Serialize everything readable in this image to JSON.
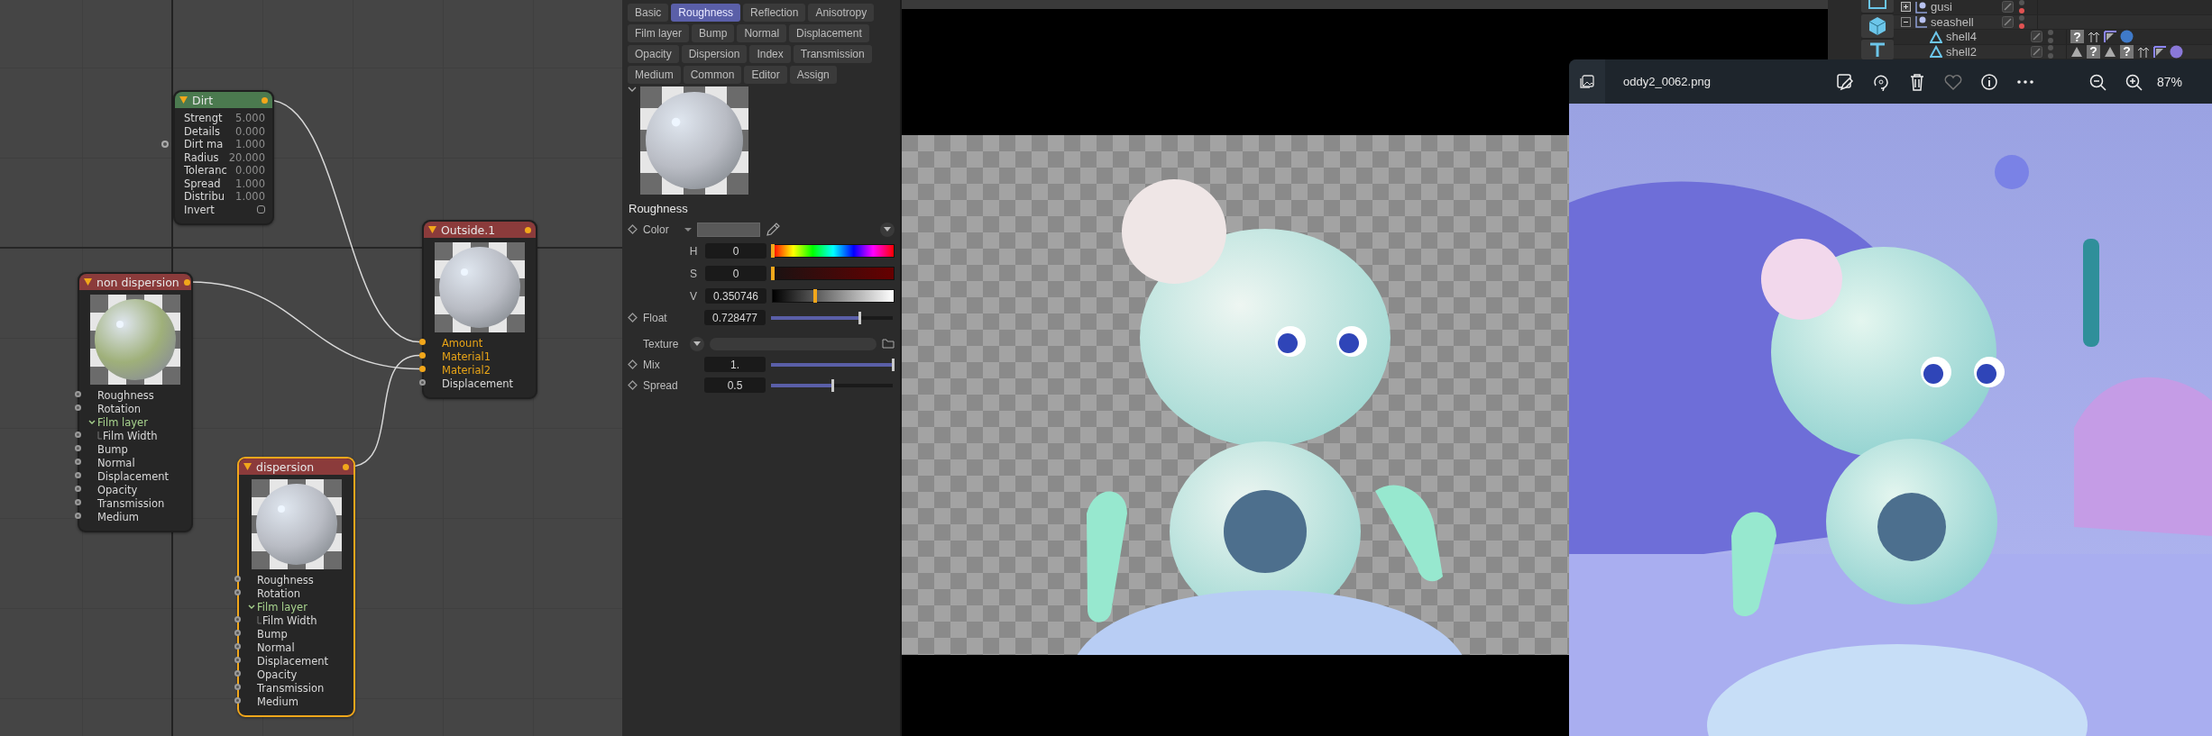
{
  "node_editor": {
    "nodes": [
      {
        "title": "Dirt",
        "kind": "texture",
        "selected": false,
        "params": [
          {
            "label": "Strengt",
            "value": "5.000",
            "input": false
          },
          {
            "label": "Details",
            "value": "0.000",
            "input": false
          },
          {
            "label": "Dirt ma",
            "value": "1.000",
            "input": true
          },
          {
            "label": "Radius",
            "value": "20.000",
            "input": false
          },
          {
            "label": "Toleranc",
            "value": "0.000",
            "input": false
          },
          {
            "label": "Spread",
            "value": "1.000",
            "input": false
          },
          {
            "label": "Distribu",
            "value": "1.000",
            "input": false
          }
        ],
        "checkbox": {
          "label": "Invert",
          "checked": false
        }
      },
      {
        "title": "Outside.1",
        "kind": "mix",
        "selected": false,
        "inputs": [
          {
            "label": "Amount",
            "connected": true
          },
          {
            "label": "Material1",
            "connected": true
          },
          {
            "label": "Material2",
            "connected": true
          },
          {
            "label": "Displacement",
            "connected": false
          }
        ]
      },
      {
        "title": "non dispersion",
        "kind": "material",
        "selected": false,
        "inputs": [
          {
            "label": "Roughness",
            "connected": false
          },
          {
            "label": "Rotation",
            "connected": false
          },
          {
            "label": "Film layer",
            "expanded": true,
            "children": [
              {
                "label": "Film Width",
                "connected": false
              }
            ]
          },
          {
            "label": "Bump",
            "connected": false
          },
          {
            "label": "Normal",
            "connected": false
          },
          {
            "label": "Displacement",
            "connected": false
          },
          {
            "label": "Opacity",
            "connected": false
          },
          {
            "label": "Transmission",
            "connected": false
          },
          {
            "label": "Medium",
            "connected": false
          }
        ]
      },
      {
        "title": "dispersion",
        "kind": "material",
        "selected": true,
        "inputs": [
          {
            "label": "Roughness",
            "connected": false
          },
          {
            "label": "Rotation",
            "connected": false
          },
          {
            "label": "Film layer",
            "expanded": true,
            "children": [
              {
                "label": "Film Width",
                "connected": false
              }
            ]
          },
          {
            "label": "Bump",
            "connected": false
          },
          {
            "label": "Normal",
            "connected": false
          },
          {
            "label": "Displacement",
            "connected": false
          },
          {
            "label": "Opacity",
            "connected": false
          },
          {
            "label": "Transmission",
            "connected": false
          },
          {
            "label": "Medium",
            "connected": false
          }
        ]
      }
    ]
  },
  "material_panel": {
    "tab_rows": [
      [
        {
          "label": "Basic",
          "selected": false
        },
        {
          "label": "Roughness",
          "selected": true
        },
        {
          "label": "Reflection",
          "selected": false
        },
        {
          "label": "Anisotropy",
          "selected": false
        }
      ],
      [
        {
          "label": "Film layer",
          "selected": false
        },
        {
          "label": "Bump",
          "selected": false
        },
        {
          "label": "Normal",
          "selected": false
        },
        {
          "label": "Displacement",
          "selected": false
        }
      ],
      [
        {
          "label": "Opacity",
          "selected": false
        },
        {
          "label": "Dispersion",
          "selected": false
        },
        {
          "label": "Index",
          "selected": false
        },
        {
          "label": "Transmission",
          "selected": false
        }
      ],
      [
        {
          "label": "Medium",
          "selected": false
        },
        {
          "label": "Common",
          "selected": false
        },
        {
          "label": "Editor",
          "selected": false
        },
        {
          "label": "Assign",
          "selected": false
        }
      ]
    ],
    "section": "Roughness",
    "color": {
      "label": "Color",
      "channels": [
        {
          "label": "H",
          "value": "0",
          "level": 0
        },
        {
          "label": "S",
          "value": "0",
          "level": 0
        },
        {
          "label": "V",
          "value": "0.350746",
          "level": 0.350746
        }
      ]
    },
    "float": {
      "label": "Float",
      "value": "0.728477",
      "level": 0.728477
    },
    "texture": {
      "label": "Texture"
    },
    "mix": {
      "label": "Mix",
      "value": "1.",
      "level": 1
    },
    "spread": {
      "label": "Spread",
      "value": "0.5",
      "level": 0.5
    }
  },
  "outliner": {
    "items": [
      {
        "name": "gusi",
        "expanded": false,
        "render_off": true
      },
      {
        "name": "seashell",
        "expanded": true,
        "render_off": true,
        "children": [
          {
            "name": "shell4",
            "render_off": false,
            "tags": [
              {
                "kind": "unknown",
                "label": "?"
              },
              {
                "kind": "arrows"
              },
              {
                "kind": "corner"
              },
              {
                "kind": "sphere",
                "color": "#3f7ac9"
              }
            ]
          },
          {
            "name": "shell2",
            "render_off": false,
            "tags": [
              {
                "kind": "triangle"
              },
              {
                "kind": "unknown",
                "label": "?"
              },
              {
                "kind": "triangle"
              },
              {
                "kind": "unknown",
                "label": "?"
              },
              {
                "kind": "arrows"
              },
              {
                "kind": "corner"
              },
              {
                "kind": "sphere",
                "color": "#8a78d8"
              }
            ]
          }
        ]
      }
    ]
  },
  "photo_viewer": {
    "title": "oddy2_0062.png",
    "zoom": "87%"
  }
}
